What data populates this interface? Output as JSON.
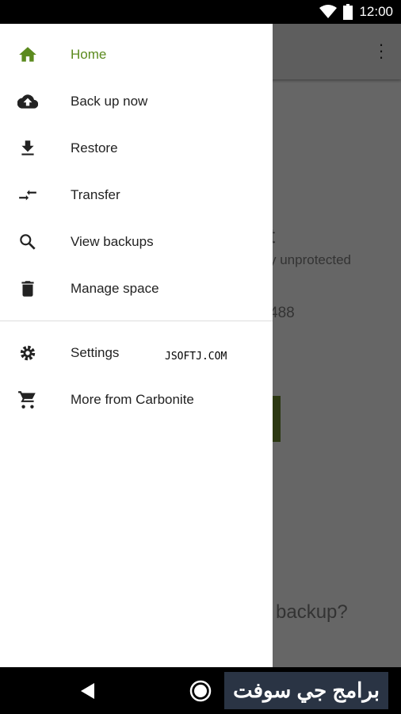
{
  "status": {
    "time": "12:00"
  },
  "drawer": {
    "items": [
      {
        "label": "Home",
        "icon": "home-icon",
        "active": true
      },
      {
        "label": "Back up now",
        "icon": "cloud-upload-icon"
      },
      {
        "label": "Restore",
        "icon": "download-icon"
      },
      {
        "label": "Transfer",
        "icon": "transfer-icon"
      },
      {
        "label": "View backups",
        "icon": "search-icon"
      },
      {
        "label": "Manage space",
        "icon": "trash-icon"
      },
      {
        "label": "Settings",
        "icon": "gear-icon"
      },
      {
        "label": "More from Carbonite",
        "icon": "cart-icon"
      }
    ]
  },
  "background": {
    "title_fragment": "t",
    "subtitle_fragment": "y unprotected",
    "number_fragment": "488",
    "question_fragment": "n backup?"
  },
  "watermark": "JSOFTJ.COM",
  "banner": "برامج جي سوفت",
  "colors": {
    "accent": "#5b8a1e"
  }
}
